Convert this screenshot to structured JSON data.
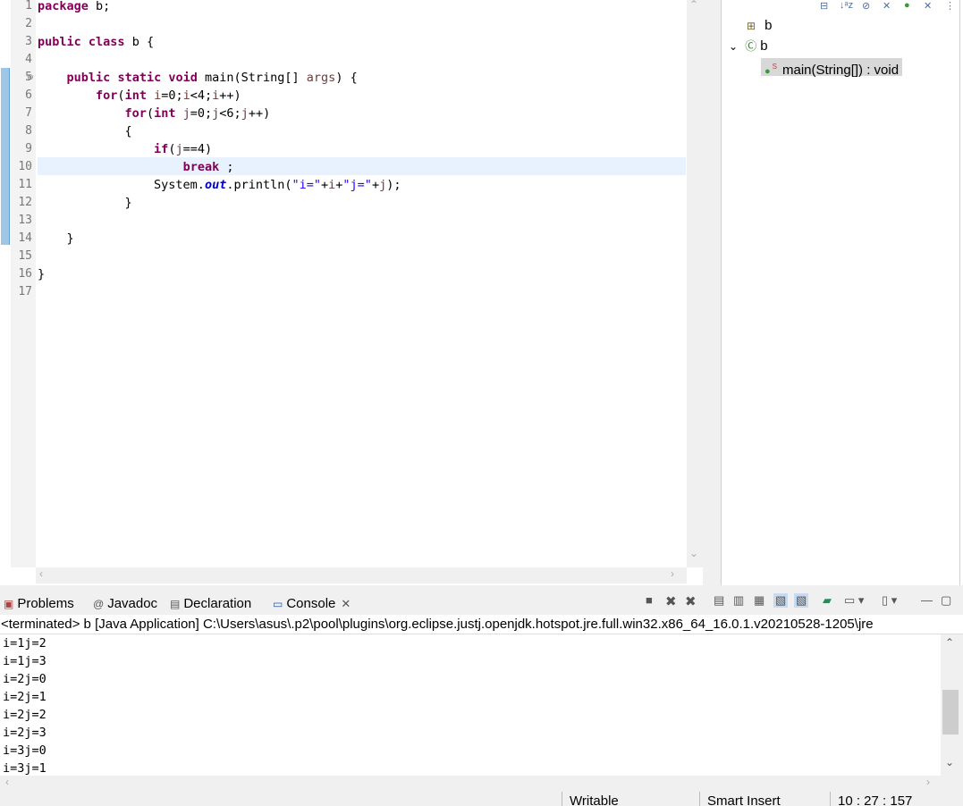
{
  "editor": {
    "lines": [
      {
        "n": "1",
        "html": "<span class=\"kw\">package</span> b;"
      },
      {
        "n": "2",
        "html": ""
      },
      {
        "n": "3",
        "html": "<span class=\"kw\">public</span> <span class=\"kw\">class</span> b {"
      },
      {
        "n": "4",
        "html": ""
      },
      {
        "n": "5",
        "html": "    <span class=\"kw\">public</span> <span class=\"kw\">static</span> <span class=\"kw\">void</span> main(String[] <span class=\"par\">args</span>) {"
      },
      {
        "n": "6",
        "html": "        <span class=\"kw\">for</span>(<span class=\"kw\">int</span> <span class=\"par\">i</span>=0;<span class=\"par\">i</span>&lt;4;<span class=\"par\">i</span>++)"
      },
      {
        "n": "7",
        "html": "            <span class=\"kw\">for</span>(<span class=\"kw\">int</span> <span class=\"par\">j</span>=0;<span class=\"par\">j</span>&lt;6;<span class=\"par\">j</span>++)"
      },
      {
        "n": "8",
        "html": "            {"
      },
      {
        "n": "9",
        "html": "                <span class=\"kw\">if</span>(<span class=\"par\">j</span>==4)"
      },
      {
        "n": "10",
        "html": "                    <span class=\"kw\">break</span> ;"
      },
      {
        "n": "11",
        "html": "                System.<span class=\"fld\">out</span>.println(<span class=\"str\">\"i=\"</span>+<span class=\"par\">i</span>+<span class=\"str\">\"j=\"</span>+<span class=\"par\">j</span>);"
      },
      {
        "n": "12",
        "html": "            }"
      },
      {
        "n": "13",
        "html": ""
      },
      {
        "n": "14",
        "html": "    }"
      },
      {
        "n": "15",
        "html": ""
      },
      {
        "n": "16",
        "html": "}"
      },
      {
        "n": "17",
        "html": ""
      }
    ]
  },
  "outline": {
    "package": "b",
    "class": "b",
    "method": "main(String[]) : void"
  },
  "tabs": {
    "problems": "Problems",
    "javadoc": "Javadoc",
    "declaration": "Declaration",
    "console": "Console"
  },
  "console": {
    "terminated": "<terminated> b [Java Application] C:\\Users\\asus\\.p2\\pool\\plugins\\org.eclipse.justj.openjdk.hotspot.jre.full.win32.x86_64_16.0.1.v20210528-1205\\jre",
    "output": [
      "i=1j=2",
      "i=1j=3",
      "i=2j=0",
      "i=2j=1",
      "i=2j=2",
      "i=2j=3",
      "i=3j=0",
      "i=3j=1"
    ]
  },
  "status": {
    "writable": "Writable",
    "insert": "Smart Insert",
    "position": "10 : 27 : 157"
  }
}
